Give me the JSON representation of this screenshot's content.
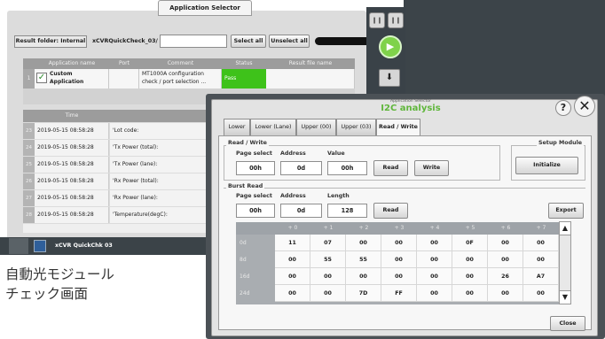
{
  "app_selector": {
    "title": "Application Selector",
    "result_folder_label": "Result folder: Internal",
    "file_name": "xCVRQuickCheck_03/",
    "select_all_label": "Select all",
    "unselect_all_label": "Unselect all",
    "columns": [
      "Application name",
      "Port",
      "Comment",
      "Status",
      "Result file name"
    ],
    "app_row": {
      "index": "1",
      "name_line1": "Custom",
      "name_line2": "Application",
      "comment_line1": "MT1000A configuration",
      "comment_line2": "check / port selection ...",
      "status": "Pass"
    },
    "log_header": "Time",
    "log_rows": [
      {
        "num": "23",
        "time": "2019-05-15 08:58:28",
        "msg": "'Lot code:"
      },
      {
        "num": "24",
        "time": "2019-05-15 08:58:28",
        "msg": "'Tx Power (total):"
      },
      {
        "num": "25",
        "time": "2019-05-15 08:58:28",
        "msg": "'Tx Power (lane):"
      },
      {
        "num": "26",
        "time": "2019-05-15 08:58:28",
        "msg": "'Rx Power (total):"
      },
      {
        "num": "27",
        "time": "2019-05-15 08:58:28",
        "msg": "'Rx Power (lane):"
      },
      {
        "num": "28",
        "time": "2019-05-15 08:58:28",
        "msg": "'Temperature(degC):"
      }
    ],
    "taskbar_label": "xCVR QuickChk 03"
  },
  "caption": {
    "line1": "自動光モジュール",
    "line2": "チェック画面"
  },
  "i2c": {
    "subtitle": "Application Selector",
    "title": "I2C analysis",
    "help_label": "?",
    "close_x_label": "✕",
    "tabs": [
      "Lower",
      "Lower (Lane)",
      "Upper (00)",
      "Upper (03)",
      "Read / Write"
    ],
    "read_write": {
      "group_label": "Read / Write",
      "page_select_label": "Page select",
      "address_label": "Address",
      "value_label": "Value",
      "page_select_value": "00h",
      "address_value": "0d",
      "value_value": "00h",
      "read_label": "Read",
      "write_label": "Write"
    },
    "setup_module": {
      "group_label": "Setup Module",
      "initialize_label": "Initialize"
    },
    "burst_read": {
      "group_label": "Burst Read",
      "page_select_label": "Page select",
      "address_label": "Address",
      "length_label": "Length",
      "page_select_value": "00h",
      "address_value": "0d",
      "length_value": "128",
      "read_label": "Read",
      "export_label": "Export"
    },
    "grid": {
      "columns": [
        "+ 0",
        "+ 1",
        "+ 2",
        "+ 3",
        "+ 4",
        "+ 5",
        "+ 6",
        "+ 7"
      ],
      "rows": [
        {
          "label": "0d",
          "cells": [
            "11",
            "07",
            "00",
            "00",
            "00",
            "0F",
            "00",
            "00"
          ]
        },
        {
          "label": "8d",
          "cells": [
            "00",
            "55",
            "55",
            "00",
            "00",
            "00",
            "00",
            "00"
          ]
        },
        {
          "label": "16d",
          "cells": [
            "00",
            "00",
            "00",
            "00",
            "00",
            "00",
            "26",
            "A7"
          ]
        },
        {
          "label": "24d",
          "cells": [
            "00",
            "00",
            "7D",
            "FF",
            "00",
            "00",
            "00",
            "00"
          ]
        }
      ]
    },
    "close_label": "Close"
  },
  "colors": {
    "accent_green": "#5fb63b",
    "pass_green": "#3ec21a",
    "dark_chrome": "#3b4348"
  }
}
